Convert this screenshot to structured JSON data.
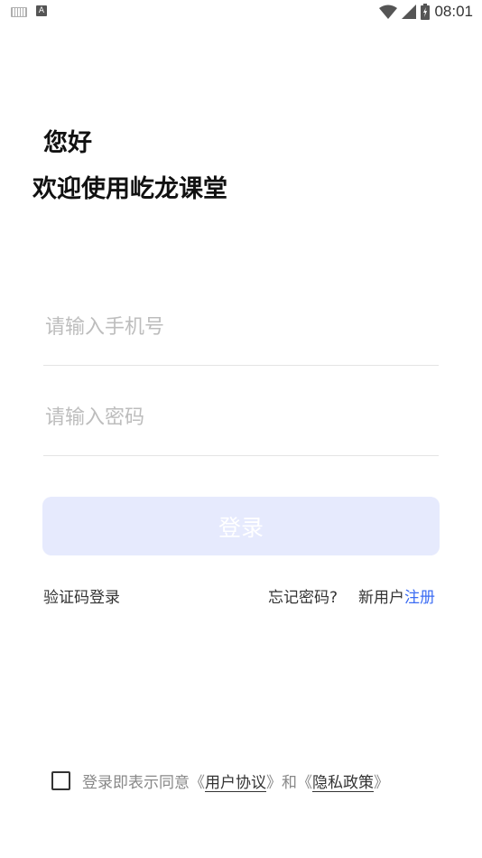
{
  "status_bar": {
    "time": "08:01",
    "left_icons": [
      "keyboard-icon",
      "a-letter-icon"
    ],
    "right_icons": [
      "wifi-icon",
      "signal-icon",
      "battery-icon"
    ]
  },
  "header": {
    "greeting": "您好",
    "welcome": "欢迎使用屹龙课堂"
  },
  "form": {
    "phone_placeholder": "请输入手机号",
    "password_placeholder": "请输入密码",
    "login_label": "登录"
  },
  "links": {
    "code_login": "验证码登录",
    "forgot_password": "忘记密码?",
    "new_user": "新用户",
    "register": "注册"
  },
  "agreement": {
    "prefix": "登录即表示同意",
    "open1": "《",
    "user_agreement": "用户协议",
    "close1": "》",
    "and": "和",
    "open2": "《",
    "privacy_policy": "隐私政策",
    "close2": "》",
    "checked": false
  },
  "colors": {
    "accent": "#3b6cf3",
    "login_button_bg": "#e6eafd"
  }
}
